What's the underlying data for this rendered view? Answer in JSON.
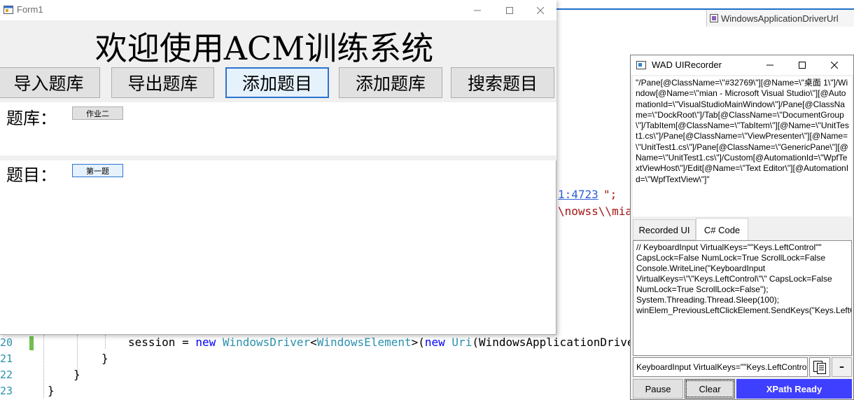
{
  "vs": {
    "nav_combo": "WindowsApplicationDriverUrl",
    "fragments": {
      "url": "1:4723",
      "url_end": "\";",
      "path": "\\nowss\\\\mia",
      "path_end": "i"
    },
    "line_numbers": [
      "20",
      "21",
      "22",
      "23"
    ],
    "code": {
      "l1_pre": "session = ",
      "l1_new": "new",
      "l1_type1": "WindowsDriver",
      "l1_lt": "<",
      "l1_type2": "WindowsElement",
      "l1_mid": ">(",
      "l1_new2": "new",
      "l1_type3": "Uri",
      "l1_post": "(WindowsApplicationDriver",
      "l2": "}",
      "l3": "}",
      "l4": "}"
    }
  },
  "form1": {
    "title": "Form1",
    "welcome": "欢迎使用ACM训练系统",
    "buttons": {
      "import_bank": "导入题库",
      "export_bank": "导出题库",
      "add_problem": "添加题目",
      "add_bank": "添加题库",
      "search_problem": "搜索题目"
    },
    "bank_label": "题库：",
    "bank_item": "作业二",
    "problem_label": "题目：",
    "problem_item": "第一题"
  },
  "wad": {
    "title": "WAD UIRecorder",
    "xpath": "\"/Pane[@ClassName=\\\"#32769\\\"][@Name=\\\"桌面 1\\\"]/Window[@Name=\\\"mian - Microsoft Visual Studio\\\"][@AutomationId=\\\"VisualStudioMainWindow\\\"]/Pane[@ClassName=\\\"DockRoot\\\"]/Tab[@ClassName=\\\"DocumentGroup\\\"]/TabItem[@ClassName=\\\"TabItem\\\"][@Name=\\\"UnitTest1.cs\\\"]/Pane[@ClassName=\\\"ViewPresenter\\\"][@Name=\\\"UnitTest1.cs\\\"]/Pane[@ClassName=\\\"GenericPane\\\"][@Name=\\\"UnitTest1.cs\\\"]/Custom[@AutomationId=\\\"WpfTextViewHost\\\"]/Edit[@Name=\\\"Text Editor\\\"][@AutomationId=\\\"WpfTextView\\\"]\"",
    "tabs": {
      "recorded": "Recorded UI",
      "csharp": "C# Code"
    },
    "code": "// KeyboardInput VirtualKeys=\"\"Keys.LeftControl\"\" CapsLock=False NumLock=True ScrollLock=False Console.WriteLine(\"KeyboardInput VirtualKeys=\\\"\\\"Keys.LeftControl\\\"\\\" CapsLock=False NumLock=True ScrollLock=False\"); System.Threading.Thread.Sleep(100); winElem_PreviousLeftClickElement.SendKeys(\"Keys.LeftControl\");",
    "status_input": "KeyboardInput VirtualKeys=\"\"Keys.LeftControl\"\"",
    "collapse": "–",
    "pause": "Pause",
    "clear": "Clear",
    "xpath_ready": "XPath Ready"
  }
}
